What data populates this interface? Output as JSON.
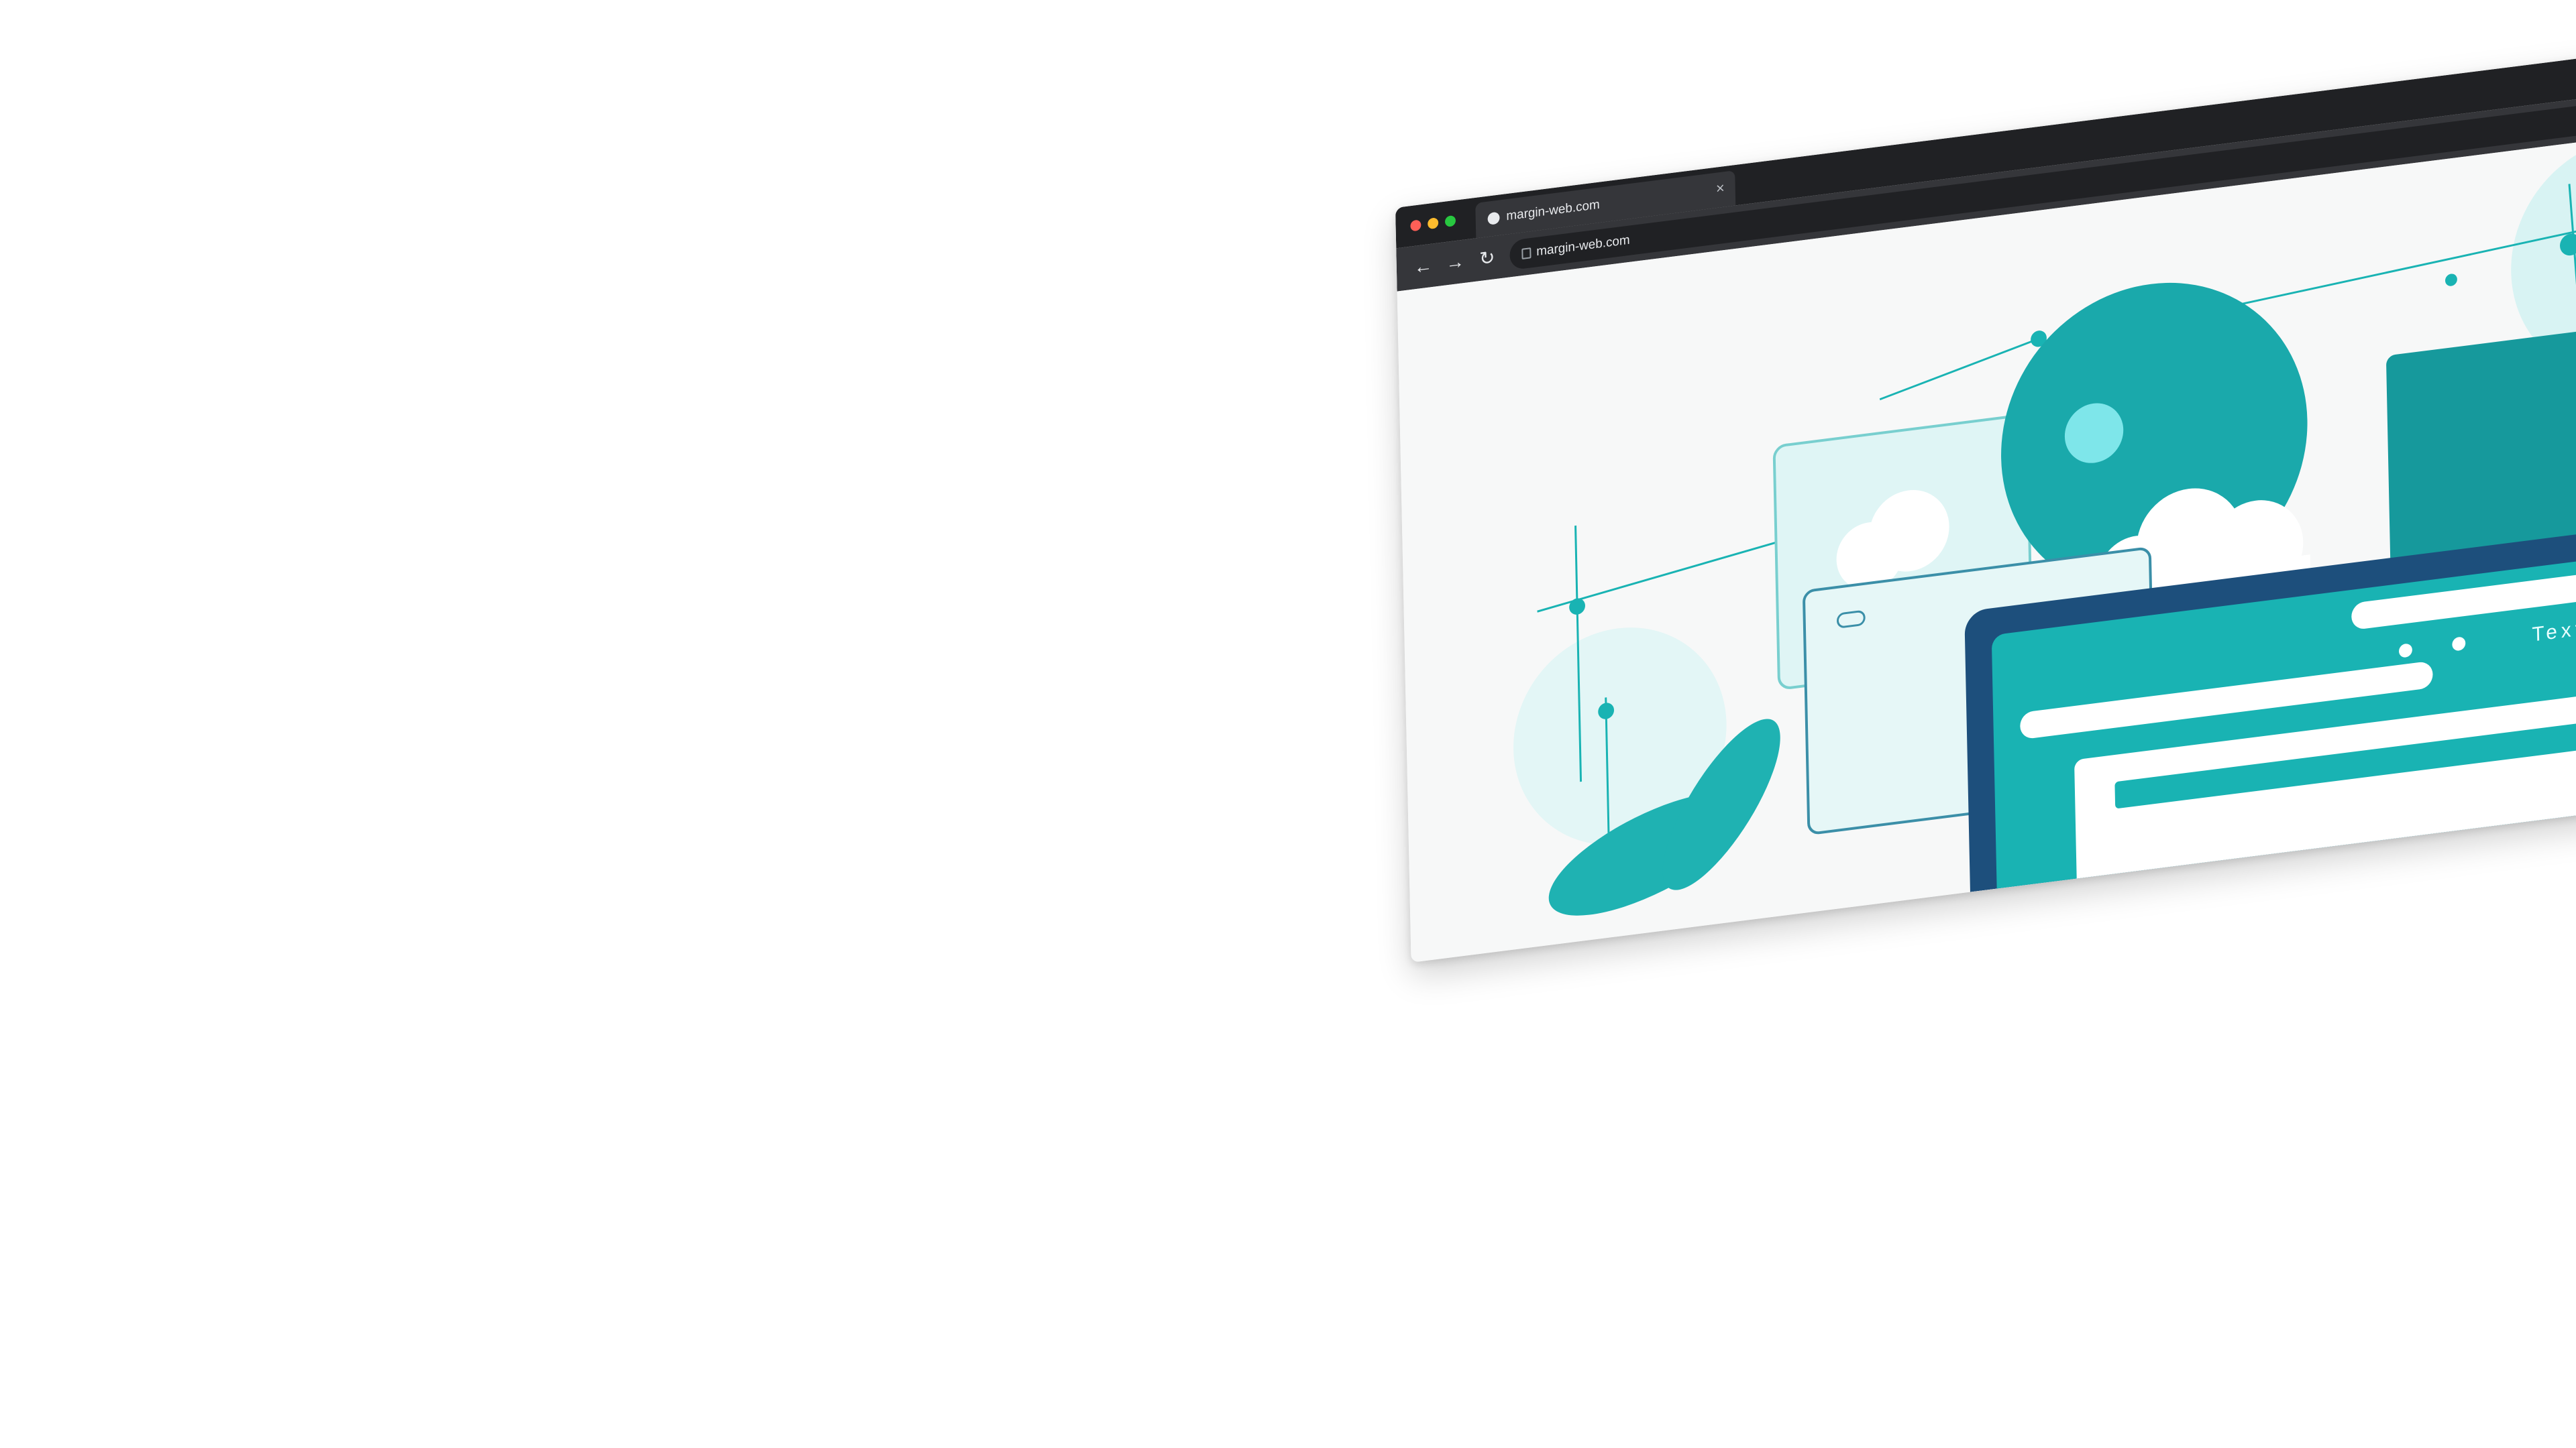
{
  "browser": {
    "tab": {
      "title": "margin-web.com",
      "favicon_icon": "globe-icon",
      "close_glyph": "×"
    },
    "toolbar": {
      "back_glyph": "←",
      "forward_glyph": "→",
      "reload_glyph": "↻",
      "url": "margin-web.com",
      "lock_icon": "lock-icon"
    }
  },
  "illustration": {
    "caption_text": "Text",
    "colors": {
      "teal": "#19b3b3",
      "teal_light": "#8fe3e3",
      "navy": "#1d4f7c",
      "white": "#ffffff"
    }
  }
}
